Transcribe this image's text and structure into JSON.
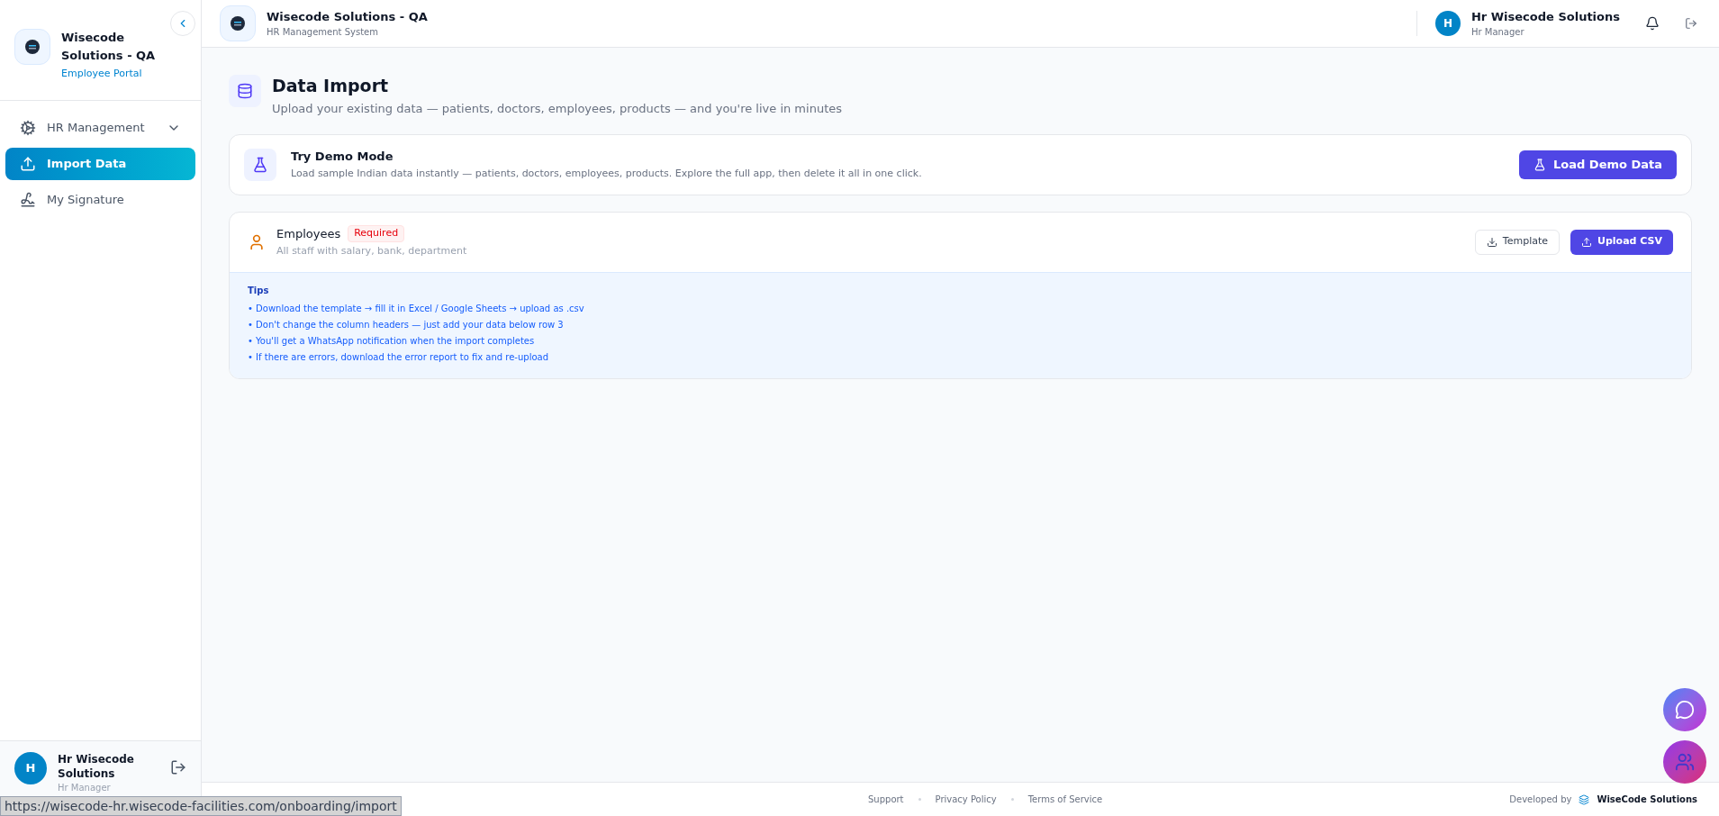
{
  "sidebar": {
    "brand": {
      "title": "Wisecode Solutions - QA",
      "subtitle": "Employee Portal"
    },
    "items": [
      {
        "label": "HR Management",
        "kind": "group",
        "expanded": false,
        "selected": false
      },
      {
        "label": "Import Data",
        "kind": "upload",
        "selected": true
      },
      {
        "label": "My Signature",
        "kind": "signature",
        "selected": false
      }
    ],
    "user": {
      "initial": "H",
      "name": "Hr Wisecode Solutions",
      "role": "Hr Manager"
    }
  },
  "header": {
    "title": "Wisecode Solutions - QA",
    "subtitle": "HR Management System",
    "user": {
      "initial": "H",
      "name": "Hr Wisecode Solutions",
      "role": "Hr Manager"
    }
  },
  "page": {
    "title": "Data Import",
    "subtitle": "Upload your existing data — patients, doctors, employees, products — and you're live in minutes"
  },
  "demo": {
    "title": "Try Demo Mode",
    "description": "Load sample Indian data instantly — patients, doctors, employees, products. Explore the full app, then delete it all in one click.",
    "button": "Load Demo Data"
  },
  "import_card": {
    "title": "Employees",
    "badge": "Required",
    "description": "All staff with salary, bank, department",
    "buttons": [
      {
        "label": "Template",
        "kind": "secondary"
      },
      {
        "label": "Upload CSV",
        "kind": "primary"
      }
    ],
    "tips": {
      "title": "Tips",
      "items": [
        "• Download the template → fill it in Excel / Google Sheets → upload as .csv",
        "• Don't change the column headers — just add your data below row 3",
        "• You'll get a WhatsApp notification when the import completes",
        "• If there are errors, download the error report to fix and re-upload"
      ]
    }
  },
  "footer": {
    "links": [
      "Support",
      "Privacy Policy",
      "Terms of Service"
    ],
    "developed_by": "Developed by",
    "brand": "WiseCode Solutions"
  },
  "status_url": "https://wisecode-hr.wisecode-facilities.com/onboarding/import"
}
